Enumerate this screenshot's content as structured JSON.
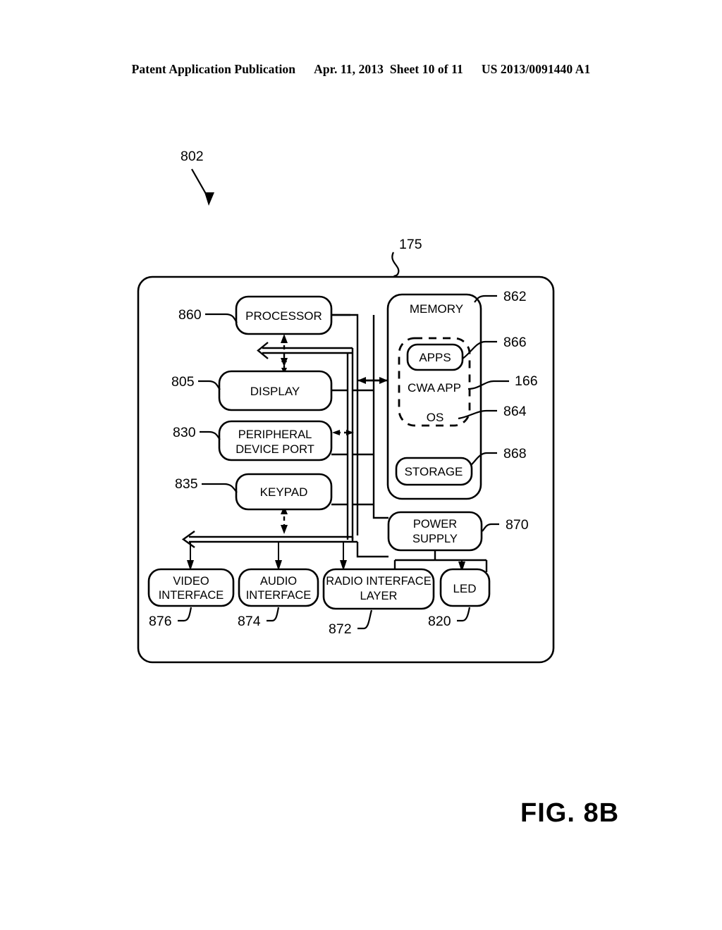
{
  "header": {
    "publication": "Patent Application Publication",
    "date_sheet": "Apr. 11, 2013  Sheet 10 of 11",
    "patent_number": "US 2013/0091440 A1"
  },
  "figure": {
    "caption": "FIG. 8B",
    "system_ref": "802",
    "device_ref": "175"
  },
  "blocks": {
    "processor": {
      "label": "PROCESSOR",
      "ref": "860"
    },
    "display": {
      "label": "DISPLAY",
      "ref": "805"
    },
    "peripheral_device_port": {
      "label_line1": "PERIPHERAL",
      "label_line2": "DEVICE PORT",
      "ref": "830"
    },
    "keypad": {
      "label": "KEYPAD",
      "ref": "835"
    },
    "memory": {
      "label": "MEMORY",
      "ref": "862"
    },
    "apps": {
      "label": "APPS",
      "ref": "866"
    },
    "cwa_app": {
      "label": "CWA APP",
      "ref": "166"
    },
    "os": {
      "label": "OS",
      "ref": "864"
    },
    "storage": {
      "label": "STORAGE",
      "ref": "868"
    },
    "power_supply": {
      "label_line1": "POWER",
      "label_line2": "SUPPLY",
      "ref": "870"
    },
    "video_interface": {
      "label_line1": "VIDEO",
      "label_line2": "INTERFACE",
      "ref": "876"
    },
    "audio_interface": {
      "label_line1": "AUDIO",
      "label_line2": "INTERFACE",
      "ref": "874"
    },
    "radio_interface_layer": {
      "label_line1": "RADIO INTERFACE",
      "label_line2": "LAYER",
      "ref": "872"
    },
    "led": {
      "label": "LED",
      "ref": "820"
    }
  },
  "colors": {
    "ink": "#000000",
    "paper": "#ffffff"
  }
}
